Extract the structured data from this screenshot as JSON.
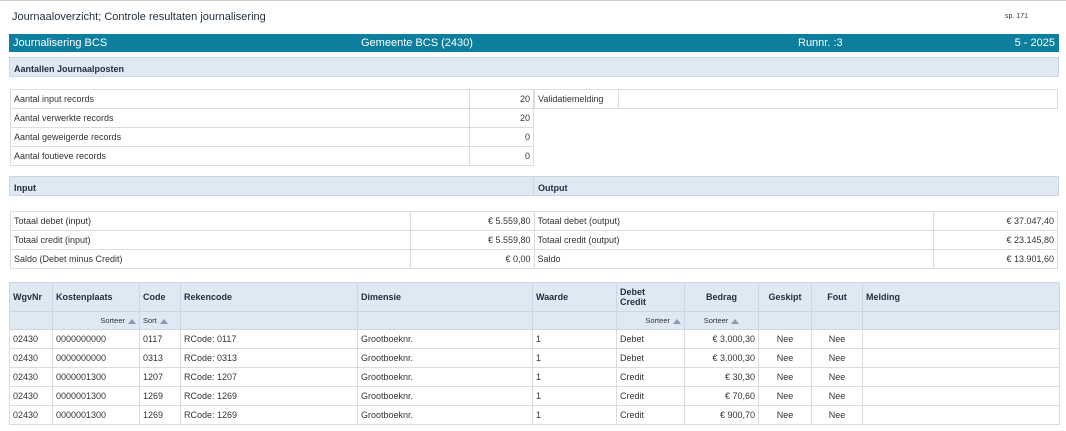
{
  "header": {
    "title": "Journaaloverzicht; Controle resultaten journalisering",
    "page": "sp. 171"
  },
  "bar": {
    "left": "Journalisering BCS",
    "center": "Gemeente BCS (2430)",
    "runnr": "Runnr. :3",
    "period": "5 - 2025"
  },
  "aantallen": {
    "title": "Aantallen Journaalposten",
    "rows": [
      {
        "label": "Aantal input records",
        "value": "20"
      },
      {
        "label": "Aantal verwerkte records",
        "value": "20"
      },
      {
        "label": "Aantal geweigerde records",
        "value": "0"
      },
      {
        "label": "Aantal foutieve records",
        "value": "0"
      }
    ],
    "validatie_label": "Validatiemelding",
    "validatie_value": ""
  },
  "input": {
    "title": "Input",
    "rows": [
      {
        "label": "Totaal debet (input)",
        "value": "€ 5.559,80"
      },
      {
        "label": "Totaal credit (input)",
        "value": "€ 5.559,80"
      },
      {
        "label": "Saldo (Debet minus Credit)",
        "value": "€ 0,00"
      }
    ]
  },
  "output": {
    "title": "Output",
    "rows": [
      {
        "label": "Totaal debet (output)",
        "value": "€ 37.047,40"
      },
      {
        "label": "Totaal credit (output)",
        "value": "€ 23.145,80"
      },
      {
        "label": "Saldo",
        "value": "€ 13.901,60"
      }
    ]
  },
  "table": {
    "columns": {
      "wgvnr": "WgvNr",
      "kostenplaats": "Kostenplaats",
      "code": "Code",
      "rekencode": "Rekencode",
      "dimensie": "Dimensie",
      "waarde": "Waarde",
      "debet": "Debet",
      "credit": "Credit",
      "bedrag": "Bedrag",
      "geskipt": "Geskipt",
      "fout": "Fout",
      "melding": "Melding"
    },
    "sort": {
      "kostenplaats": "Sorteer",
      "code": "Sort",
      "debetcredit": "Sorteer",
      "bedrag": "Sorteer"
    },
    "rows": [
      {
        "wgvnr": "02430",
        "kostenplaats": "0000000000",
        "code": "0117",
        "rekencode": "RCode: 0117",
        "dimensie": "Grootboeknr.",
        "waarde": "1",
        "dc": "Debet",
        "bedrag": "€ 3.000,30",
        "geskipt": "Nee",
        "fout": "Nee",
        "melding": ""
      },
      {
        "wgvnr": "02430",
        "kostenplaats": "0000000000",
        "code": "0313",
        "rekencode": "RCode: 0313",
        "dimensie": "Grootboeknr.",
        "waarde": "1",
        "dc": "Debet",
        "bedrag": "€ 3.000,30",
        "geskipt": "Nee",
        "fout": "Nee",
        "melding": ""
      },
      {
        "wgvnr": "02430",
        "kostenplaats": "0000001300",
        "code": "1207",
        "rekencode": "RCode: 1207",
        "dimensie": "Grootboeknr.",
        "waarde": "1",
        "dc": "Credit",
        "bedrag": "€ 30,30",
        "geskipt": "Nee",
        "fout": "Nee",
        "melding": ""
      },
      {
        "wgvnr": "02430",
        "kostenplaats": "0000001300",
        "code": "1269",
        "rekencode": "RCode: 1269",
        "dimensie": "Grootboeknr.",
        "waarde": "1",
        "dc": "Credit",
        "bedrag": "€ 70,60",
        "geskipt": "Nee",
        "fout": "Nee",
        "melding": ""
      },
      {
        "wgvnr": "02430",
        "kostenplaats": "0000001300",
        "code": "1269",
        "rekencode": "RCode: 1269",
        "dimensie": "Grootboeknr.",
        "waarde": "1",
        "dc": "Credit",
        "bedrag": "€ 900,70",
        "geskipt": "Nee",
        "fout": "Nee",
        "melding": ""
      }
    ]
  }
}
